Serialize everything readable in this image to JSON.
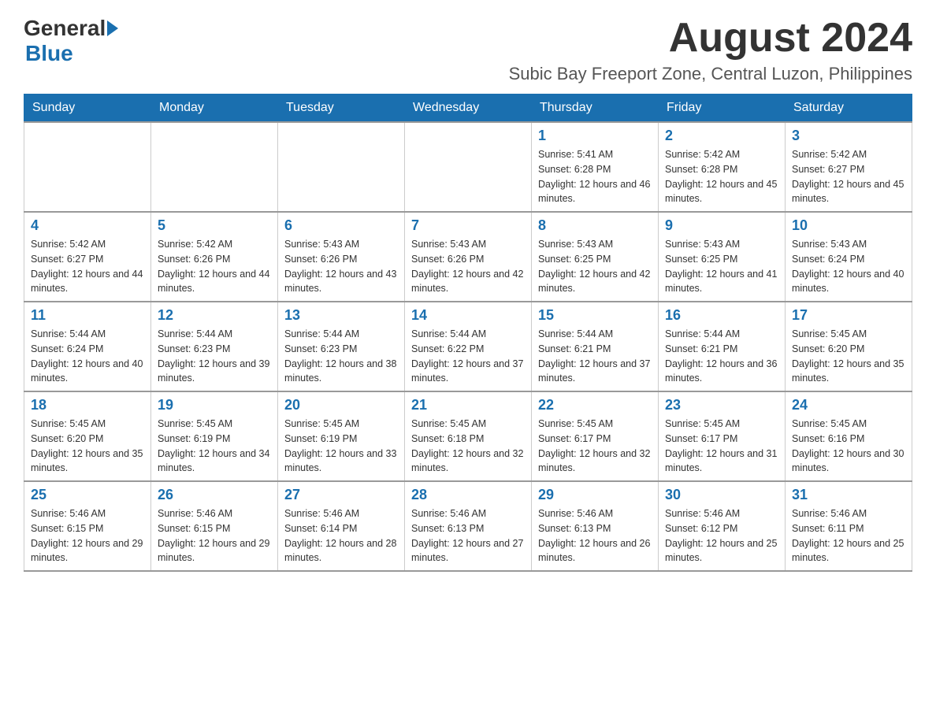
{
  "header": {
    "logo_general": "General",
    "logo_blue": "Blue",
    "month_year": "August 2024",
    "location": "Subic Bay Freeport Zone, Central Luzon, Philippines"
  },
  "days_of_week": [
    "Sunday",
    "Monday",
    "Tuesday",
    "Wednesday",
    "Thursday",
    "Friday",
    "Saturday"
  ],
  "weeks": [
    [
      {
        "day": "",
        "info": ""
      },
      {
        "day": "",
        "info": ""
      },
      {
        "day": "",
        "info": ""
      },
      {
        "day": "",
        "info": ""
      },
      {
        "day": "1",
        "info": "Sunrise: 5:41 AM\nSunset: 6:28 PM\nDaylight: 12 hours and 46 minutes."
      },
      {
        "day": "2",
        "info": "Sunrise: 5:42 AM\nSunset: 6:28 PM\nDaylight: 12 hours and 45 minutes."
      },
      {
        "day": "3",
        "info": "Sunrise: 5:42 AM\nSunset: 6:27 PM\nDaylight: 12 hours and 45 minutes."
      }
    ],
    [
      {
        "day": "4",
        "info": "Sunrise: 5:42 AM\nSunset: 6:27 PM\nDaylight: 12 hours and 44 minutes."
      },
      {
        "day": "5",
        "info": "Sunrise: 5:42 AM\nSunset: 6:26 PM\nDaylight: 12 hours and 44 minutes."
      },
      {
        "day": "6",
        "info": "Sunrise: 5:43 AM\nSunset: 6:26 PM\nDaylight: 12 hours and 43 minutes."
      },
      {
        "day": "7",
        "info": "Sunrise: 5:43 AM\nSunset: 6:26 PM\nDaylight: 12 hours and 42 minutes."
      },
      {
        "day": "8",
        "info": "Sunrise: 5:43 AM\nSunset: 6:25 PM\nDaylight: 12 hours and 42 minutes."
      },
      {
        "day": "9",
        "info": "Sunrise: 5:43 AM\nSunset: 6:25 PM\nDaylight: 12 hours and 41 minutes."
      },
      {
        "day": "10",
        "info": "Sunrise: 5:43 AM\nSunset: 6:24 PM\nDaylight: 12 hours and 40 minutes."
      }
    ],
    [
      {
        "day": "11",
        "info": "Sunrise: 5:44 AM\nSunset: 6:24 PM\nDaylight: 12 hours and 40 minutes."
      },
      {
        "day": "12",
        "info": "Sunrise: 5:44 AM\nSunset: 6:23 PM\nDaylight: 12 hours and 39 minutes."
      },
      {
        "day": "13",
        "info": "Sunrise: 5:44 AM\nSunset: 6:23 PM\nDaylight: 12 hours and 38 minutes."
      },
      {
        "day": "14",
        "info": "Sunrise: 5:44 AM\nSunset: 6:22 PM\nDaylight: 12 hours and 37 minutes."
      },
      {
        "day": "15",
        "info": "Sunrise: 5:44 AM\nSunset: 6:21 PM\nDaylight: 12 hours and 37 minutes."
      },
      {
        "day": "16",
        "info": "Sunrise: 5:44 AM\nSunset: 6:21 PM\nDaylight: 12 hours and 36 minutes."
      },
      {
        "day": "17",
        "info": "Sunrise: 5:45 AM\nSunset: 6:20 PM\nDaylight: 12 hours and 35 minutes."
      }
    ],
    [
      {
        "day": "18",
        "info": "Sunrise: 5:45 AM\nSunset: 6:20 PM\nDaylight: 12 hours and 35 minutes."
      },
      {
        "day": "19",
        "info": "Sunrise: 5:45 AM\nSunset: 6:19 PM\nDaylight: 12 hours and 34 minutes."
      },
      {
        "day": "20",
        "info": "Sunrise: 5:45 AM\nSunset: 6:19 PM\nDaylight: 12 hours and 33 minutes."
      },
      {
        "day": "21",
        "info": "Sunrise: 5:45 AM\nSunset: 6:18 PM\nDaylight: 12 hours and 32 minutes."
      },
      {
        "day": "22",
        "info": "Sunrise: 5:45 AM\nSunset: 6:17 PM\nDaylight: 12 hours and 32 minutes."
      },
      {
        "day": "23",
        "info": "Sunrise: 5:45 AM\nSunset: 6:17 PM\nDaylight: 12 hours and 31 minutes."
      },
      {
        "day": "24",
        "info": "Sunrise: 5:45 AM\nSunset: 6:16 PM\nDaylight: 12 hours and 30 minutes."
      }
    ],
    [
      {
        "day": "25",
        "info": "Sunrise: 5:46 AM\nSunset: 6:15 PM\nDaylight: 12 hours and 29 minutes."
      },
      {
        "day": "26",
        "info": "Sunrise: 5:46 AM\nSunset: 6:15 PM\nDaylight: 12 hours and 29 minutes."
      },
      {
        "day": "27",
        "info": "Sunrise: 5:46 AM\nSunset: 6:14 PM\nDaylight: 12 hours and 28 minutes."
      },
      {
        "day": "28",
        "info": "Sunrise: 5:46 AM\nSunset: 6:13 PM\nDaylight: 12 hours and 27 minutes."
      },
      {
        "day": "29",
        "info": "Sunrise: 5:46 AM\nSunset: 6:13 PM\nDaylight: 12 hours and 26 minutes."
      },
      {
        "day": "30",
        "info": "Sunrise: 5:46 AM\nSunset: 6:12 PM\nDaylight: 12 hours and 25 minutes."
      },
      {
        "day": "31",
        "info": "Sunrise: 5:46 AM\nSunset: 6:11 PM\nDaylight: 12 hours and 25 minutes."
      }
    ]
  ]
}
